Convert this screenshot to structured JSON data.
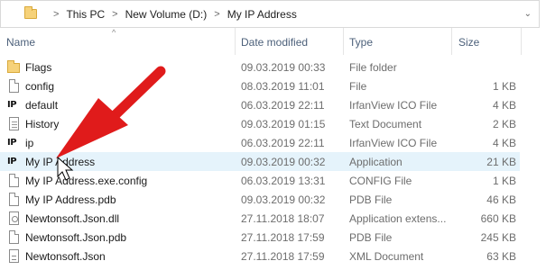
{
  "address": {
    "crumbs": [
      "This PC",
      "New Volume (D:)",
      "My IP Address"
    ],
    "separator": ">",
    "dropdown": "⌄"
  },
  "header": {
    "sort_arrow": "^",
    "name": "Name",
    "date_modified": "Date modified",
    "type": "Type",
    "size": "Size"
  },
  "files": [
    {
      "icon": "folder-icon",
      "name": "Flags",
      "date": "09.03.2019 00:33",
      "type": "File folder",
      "size": ""
    },
    {
      "icon": "file-icon",
      "name": "config",
      "date": "08.03.2019 11:01",
      "type": "File",
      "size": "1 KB"
    },
    {
      "icon": "irfanview-ico-icon",
      "name": "default",
      "date": "06.03.2019 22:11",
      "type": "IrfanView ICO File",
      "size": "4 KB"
    },
    {
      "icon": "text-document-icon",
      "name": "History",
      "date": "09.03.2019 01:15",
      "type": "Text Document",
      "size": "2 KB"
    },
    {
      "icon": "irfanview-ico-icon",
      "name": "ip",
      "date": "06.03.2019 22:11",
      "type": "IrfanView ICO File",
      "size": "4 KB"
    },
    {
      "icon": "application-icon",
      "name": "My IP Address",
      "date": "09.03.2019 00:32",
      "type": "Application",
      "size": "21 KB"
    },
    {
      "icon": "file-icon",
      "name": "My IP Address.exe.config",
      "date": "06.03.2019 13:31",
      "type": "CONFIG File",
      "size": "1 KB"
    },
    {
      "icon": "file-icon",
      "name": "My IP Address.pdb",
      "date": "09.03.2019 00:32",
      "type": "PDB File",
      "size": "46 KB"
    },
    {
      "icon": "dll-icon",
      "name": "Newtonsoft.Json.dll",
      "date": "27.11.2018 18:07",
      "type": "Application extens...",
      "size": "660 KB"
    },
    {
      "icon": "file-icon",
      "name": "Newtonsoft.Json.pdb",
      "date": "27.11.2018 17:59",
      "type": "PDB File",
      "size": "245 KB"
    },
    {
      "icon": "xml-document-icon",
      "name": "Newtonsoft.Json",
      "date": "27.11.2018 17:59",
      "type": "XML Document",
      "size": "63 KB"
    }
  ],
  "icon_glyphs": {
    "ip": "IP"
  },
  "colors": {
    "highlight_row": "#e5f3fb",
    "header_text": "#4c607a",
    "annotation_arrow": "#e01b1b"
  }
}
